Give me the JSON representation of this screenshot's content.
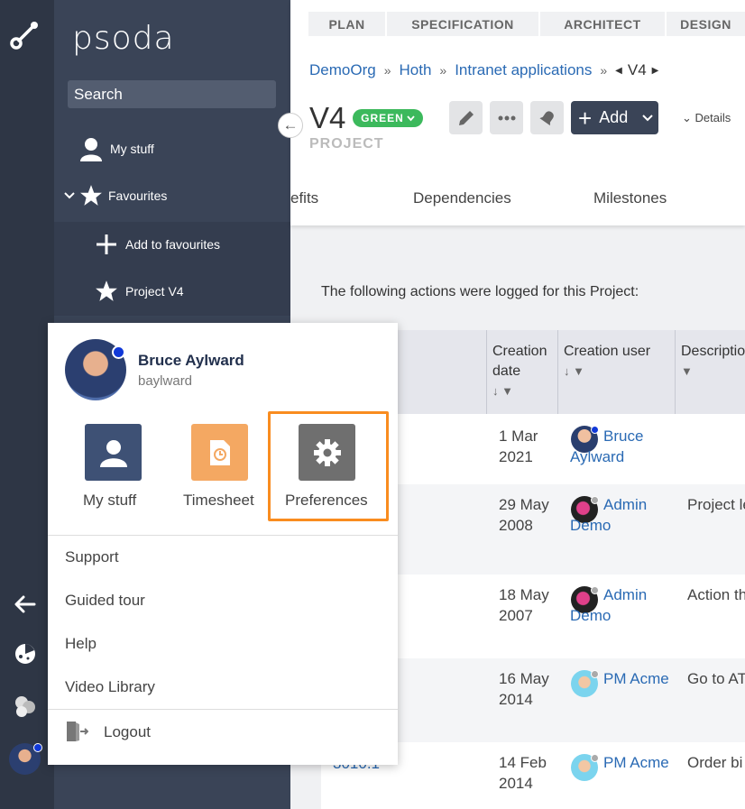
{
  "app": {
    "brand": "psoda"
  },
  "sidebar": {
    "search_placeholder": "Search",
    "items": [
      {
        "label": "My stuff"
      },
      {
        "label": "Favourites"
      },
      {
        "label": "Add to favourites"
      },
      {
        "label": "Project V4"
      }
    ]
  },
  "steps": [
    "PLAN",
    "SPECIFICATION",
    "ARCHITECT",
    "DESIGN"
  ],
  "breadcrumb": {
    "items": [
      "DemoOrg",
      "Hoth",
      "Intranet applications"
    ],
    "sep": "»",
    "current": "V4"
  },
  "project": {
    "title": "V4",
    "status": "GREEN",
    "status_color": "#3cb95c",
    "type": "PROJECT",
    "add_label": "Add",
    "details_label": "Details"
  },
  "tabs": [
    "efits",
    "Dependencies",
    "Milestones"
  ],
  "log": {
    "intro": "The following actions were logged for this Project:",
    "columns": [
      "Creation date",
      "Creation user",
      "Descriptio"
    ],
    "rows": [
      {
        "date": "1 Mar 2021",
        "user": "Bruce Aylward",
        "desc": "",
        "ref": ""
      },
      {
        "date": "29 May 2008",
        "user": "Admin Demo",
        "desc": "Project le",
        "ref": ""
      },
      {
        "date": "18 May 2007",
        "user": "Admin Demo",
        "desc": "Action th",
        "ref": ""
      },
      {
        "date": "16 May 2014",
        "user": "PM Acme",
        "desc": "Go to AT",
        "ref": ""
      },
      {
        "date": "14 Feb 2014",
        "user": "PM Acme",
        "desc": "Order bi",
        "ref": "3010.1"
      }
    ]
  },
  "user_menu": {
    "name": "Bruce Aylward",
    "username": "baylward",
    "tiles": [
      {
        "label": "My stuff",
        "color": "#3e5175"
      },
      {
        "label": "Timesheet",
        "color": "#f4a862"
      },
      {
        "label": "Preferences",
        "color": "#6f6f6f"
      }
    ],
    "highlight_color": "#f98c1f",
    "links": [
      "Support",
      "Guided tour",
      "Help",
      "Video Library"
    ],
    "logout": "Logout"
  }
}
